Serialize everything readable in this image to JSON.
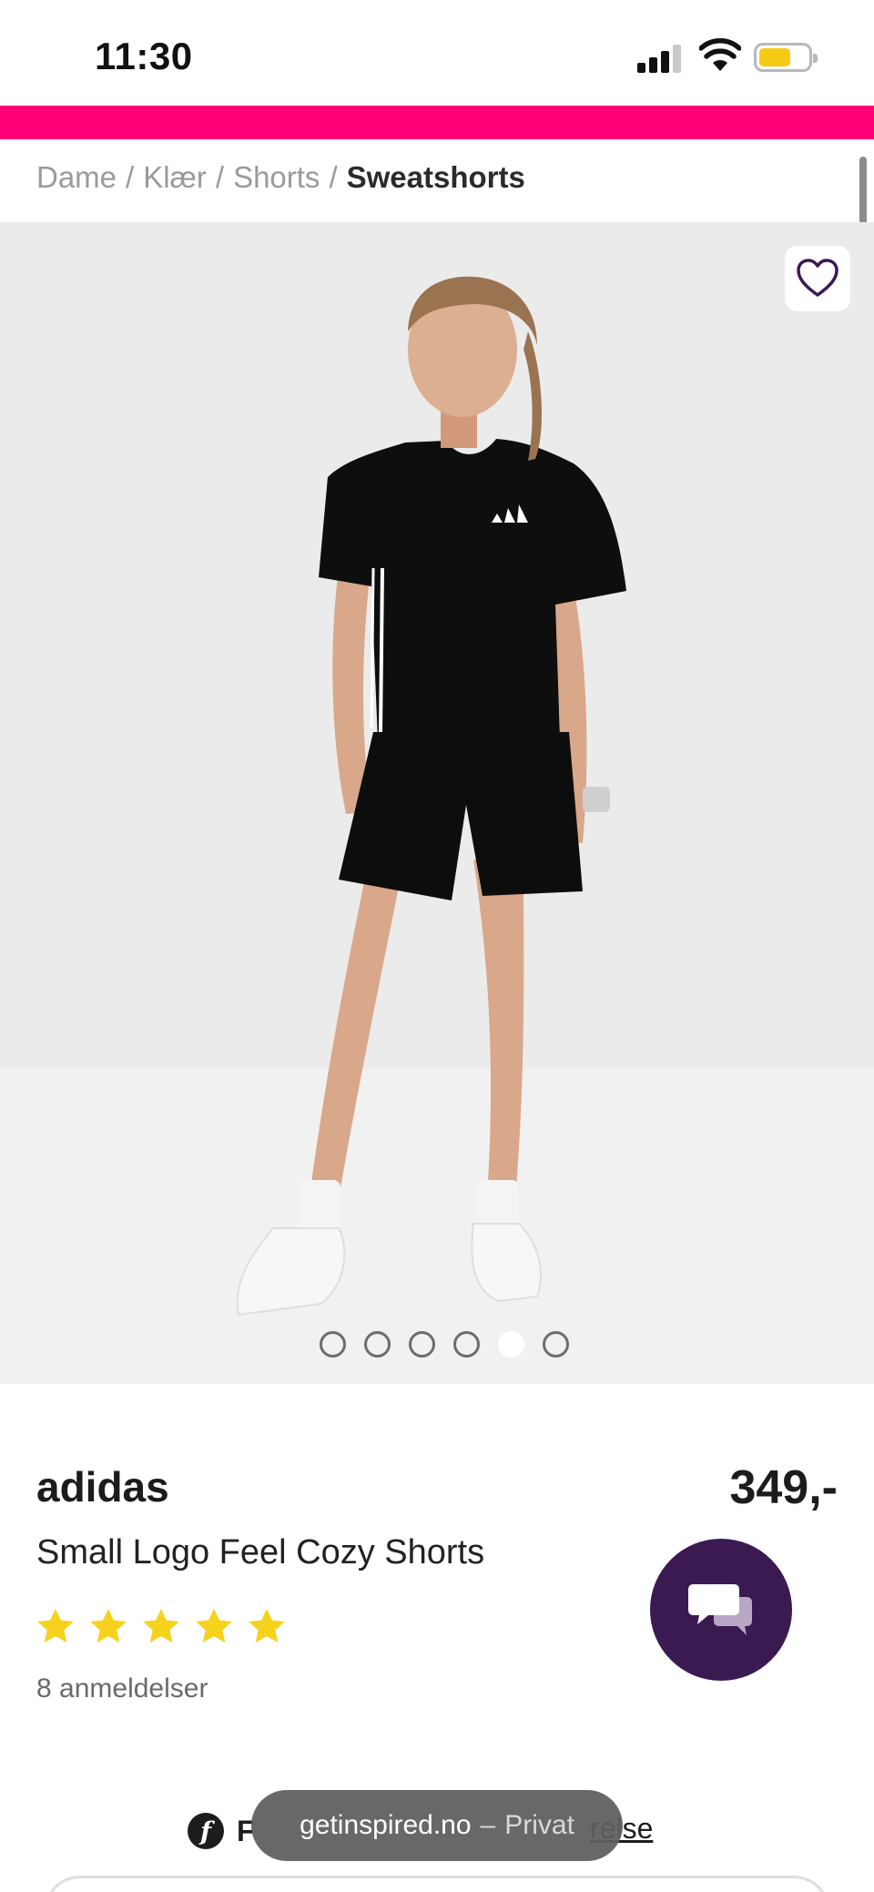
{
  "status_bar": {
    "time": "11:30",
    "icons": [
      "cellular-signal-icon",
      "wifi-icon",
      "battery-icon"
    ],
    "battery_color": "#f6c914"
  },
  "theme": {
    "accent": "#ff0077",
    "chat_button": "#3b1a52",
    "star": "#f7d21d"
  },
  "breadcrumb": {
    "items": [
      "Dame",
      "Klær",
      "Shorts"
    ],
    "separator": "/",
    "current": "Sweatshorts"
  },
  "gallery": {
    "image_count": 6,
    "active_index": 4,
    "wishlist_icon": "heart-outline-icon"
  },
  "product": {
    "brand": "adidas",
    "name": "Small Logo Feel Cozy Shorts",
    "price": "349,-",
    "rating": 5,
    "rating_max": 5,
    "reviews": "8 anmeldelser"
  },
  "payment": {
    "logo_letter": "f",
    "text": "F",
    "link": "relse"
  },
  "toast": {
    "domain": "getinspired.no",
    "dash": "–",
    "mode": "Privat"
  }
}
